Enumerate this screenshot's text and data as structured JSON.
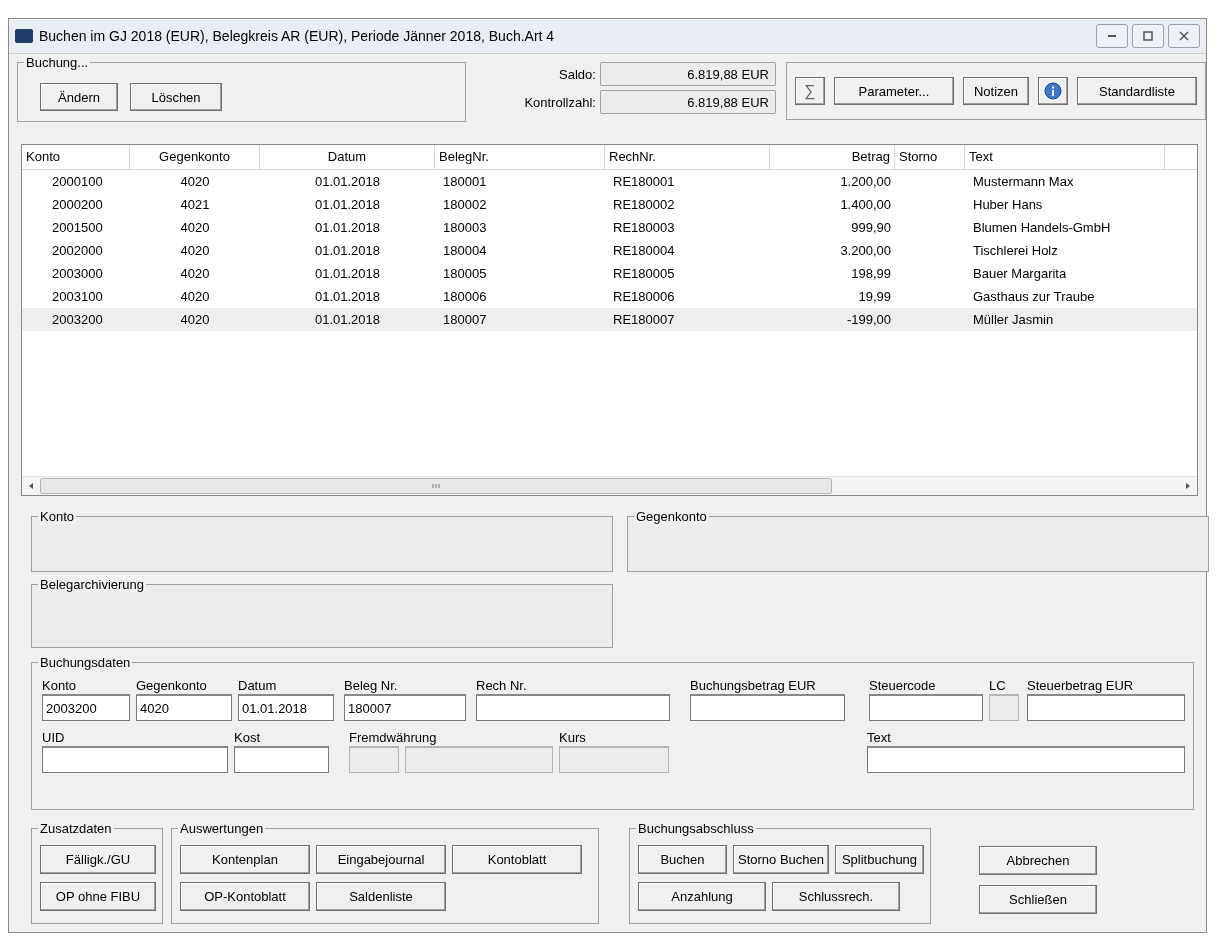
{
  "window": {
    "title": "Buchen im GJ 2018 (EUR), Belegkreis AR (EUR), Periode Jänner 2018, Buch.Art 4"
  },
  "buchung": {
    "label": "Buchung...",
    "buttons": [
      "Ändern",
      "Löschen"
    ]
  },
  "totals": [
    {
      "label": "Saldo:",
      "value": "6.819,88 EUR"
    },
    {
      "label": "Kontrollzahl:",
      "value": "6.819,88 EUR"
    }
  ],
  "toolbar": [
    {
      "kind": "sum",
      "text": "∑"
    },
    {
      "kind": "text",
      "text": "Parameter..."
    },
    {
      "kind": "text",
      "text": "Notizen"
    },
    {
      "kind": "info"
    },
    {
      "kind": "text",
      "text": "Standardliste"
    }
  ],
  "table": {
    "columns": [
      "Konto",
      "Gegenkonto",
      "Datum",
      "BelegNr.",
      "RechNr.",
      "Betrag",
      "Storno",
      "Text"
    ],
    "rows": [
      {
        "selected": false,
        "cells": [
          "2000100",
          "4020",
          "01.01.2018",
          "180001",
          "RE180001",
          "1.200,00",
          "",
          "Mustermann Max"
        ]
      },
      {
        "selected": false,
        "cells": [
          "2000200",
          "4021",
          "01.01.2018",
          "180002",
          "RE180002",
          "1.400,00",
          "",
          "Huber Hans"
        ]
      },
      {
        "selected": false,
        "cells": [
          "2001500",
          "4020",
          "01.01.2018",
          "180003",
          "RE180003",
          "999,90",
          "",
          "Blumen Handels-GmbH"
        ]
      },
      {
        "selected": false,
        "cells": [
          "2002000",
          "4020",
          "01.01.2018",
          "180004",
          "RE180004",
          "3.200,00",
          "",
          "Tischlerei Holz"
        ]
      },
      {
        "selected": false,
        "cells": [
          "2003000",
          "4020",
          "01.01.2018",
          "180005",
          "RE180005",
          "198,99",
          "",
          "Bauer Margarita"
        ]
      },
      {
        "selected": false,
        "cells": [
          "2003100",
          "4020",
          "01.01.2018",
          "180006",
          "RE180006",
          "19,99",
          "",
          "Gasthaus zur Traube"
        ]
      },
      {
        "selected": true,
        "cells": [
          "2003200",
          "4020",
          "01.01.2018",
          "180007",
          "RE180007",
          "-199,00",
          "",
          "Müller Jasmin"
        ]
      }
    ]
  },
  "info_groups": [
    {
      "label": "Konto"
    },
    {
      "label": "Gegenkonto"
    },
    {
      "label": "Belegarchivierung"
    }
  ],
  "buchungsdaten": {
    "label": "Buchungsdaten",
    "lines": [
      {
        "fields": [
          {
            "label": "Konto",
            "value": "2003200",
            "disabled": false
          },
          {
            "label": "Gegenkonto",
            "value": "4020",
            "disabled": false
          },
          {
            "label": "Datum",
            "value": "01.01.2018",
            "disabled": false
          },
          {
            "label": "Beleg Nr.",
            "value": "180007",
            "disabled": false
          },
          {
            "label": "Rech Nr.",
            "disabled": false
          },
          {
            "label": "Buchungsbetrag EUR",
            "disabled": false
          },
          {
            "label": "Steuercode",
            "disabled": false
          },
          {
            "label": "LC",
            "disabled": true
          },
          {
            "label": "Steuerbetrag EUR",
            "disabled": false
          }
        ]
      },
      {
        "fields": [
          {
            "label": "UID",
            "disabled": false
          },
          {
            "label": "Kost",
            "disabled": false
          },
          {
            "label": "Fremdwährung",
            "disabled": true,
            "split": true
          },
          {
            "label": "Kurs",
            "disabled": true
          },
          {
            "label": "Text",
            "disabled": false
          }
        ]
      }
    ]
  },
  "button_groups": [
    {
      "label": "Zusatzdaten",
      "rows": [
        [
          "Fälligk./GU"
        ],
        [
          "OP ohne FIBU"
        ]
      ]
    },
    {
      "label": "Auswertungen",
      "rows": [
        [
          "Kontenplan",
          "Eingabejournal",
          "Kontoblatt"
        ],
        [
          "OP-Kontoblatt",
          "Saldenliste"
        ]
      ]
    },
    {
      "label": "Buchungsabschluss",
      "rows": [
        [
          "Buchen",
          "Storno Buchen",
          "Splitbuchung"
        ],
        [
          "Anzahlung",
          "Schlussrech."
        ]
      ]
    }
  ],
  "final_buttons": [
    "Abbrechen",
    "Schließen"
  ]
}
